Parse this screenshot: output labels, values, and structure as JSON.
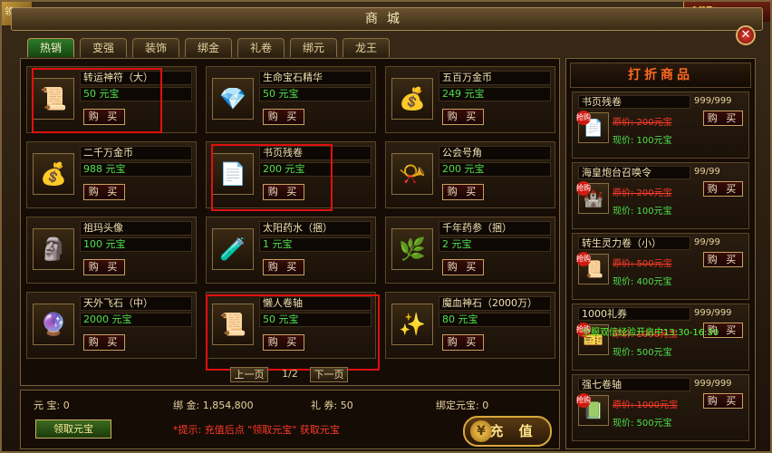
{
  "corner_badge": "领取",
  "vip_badge": "VIP",
  "window": {
    "title": "商城",
    "close": "✕"
  },
  "tabs": [
    "热销",
    "变强",
    "装饰",
    "绑金",
    "礼卷",
    "绑元",
    "龙王"
  ],
  "buy_label": "购 买",
  "items": [
    {
      "name": "转运神符（大）",
      "price": "50 元宝",
      "icon": "talisman-icon",
      "glyph": "📜"
    },
    {
      "name": "生命宝石精华",
      "price": "50 元宝",
      "icon": "red-gem-icon",
      "glyph": "💎"
    },
    {
      "name": "五百万金币",
      "price": "249 元宝",
      "icon": "gold-coin-bag-icon",
      "glyph": "💰"
    },
    {
      "name": "二千万金币",
      "price": "988 元宝",
      "icon": "gold-coin-bag-icon",
      "glyph": "💰"
    },
    {
      "name": "书页残卷",
      "price": "200 元宝",
      "icon": "scroll-page-icon",
      "glyph": "📄"
    },
    {
      "name": "公会号角",
      "price": "200 元宝",
      "icon": "horn-icon",
      "glyph": "📯"
    },
    {
      "name": "祖玛头像",
      "price": "100 元宝",
      "icon": "statue-icon",
      "glyph": "🗿"
    },
    {
      "name": "太阳药水（捆）",
      "price": "1 元宝",
      "icon": "potion-bundle-icon",
      "glyph": "🧪"
    },
    {
      "name": "千年药参（捆）",
      "price": "2 元宝",
      "icon": "ginseng-bundle-icon",
      "glyph": "🌿"
    },
    {
      "name": "天外飞石（中）",
      "price": "2000 元宝",
      "icon": "crystal-stone-icon",
      "glyph": "🔮"
    },
    {
      "name": "懒人卷轴",
      "price": "50 元宝",
      "icon": "scroll-icon",
      "glyph": "📜"
    },
    {
      "name": "魔血神石（2000万）",
      "price": "80 元宝",
      "icon": "blue-orb-icon",
      "glyph": "✨"
    }
  ],
  "pager": {
    "prev": "上一页",
    "page": "1/2",
    "next": "下一页"
  },
  "stats": {
    "yuanbao": "元 宝: 0",
    "bindgold": "绑 金: 1,854,800",
    "coupon": "礼 券: 50",
    "bound_yuanbao": "绑定元宝: 0"
  },
  "claim_button": "领取元宝",
  "tip": "*提示: 充值后点 \"领取元宝\" 获取元宝",
  "recharge_button": "充 值",
  "discount": {
    "title": "打折商品",
    "tag": "抢购",
    "items": [
      {
        "name": "书页残卷",
        "stock": "999/999",
        "orig": "原价: 200元宝",
        "now": "现价: 100元宝",
        "icon": "scroll-page-icon",
        "glyph": "📄"
      },
      {
        "name": "海皇炮台召唤令",
        "stock": "99/99",
        "orig": "原价: 200元宝",
        "now": "现价: 100元宝",
        "icon": "cannon-tower-icon",
        "glyph": "🏰"
      },
      {
        "name": "转生灵力卷（小）",
        "stock": "99/99",
        "orig": "原价: 500元宝",
        "now": "现价: 400元宝",
        "icon": "scroll-icon",
        "glyph": "📜"
      },
      {
        "name": "1000礼券",
        "stock": "999/999",
        "orig": "原价: 1000元宝",
        "now": "现价: 500元宝",
        "icon": "coupon-icon",
        "glyph": "🎫"
      },
      {
        "name": "强七卷轴",
        "stock": "999/999",
        "orig": "原价: 1000元宝",
        "now": "现价: 500元宝",
        "icon": "upgrade-scroll-icon",
        "glyph": "📗"
      }
    ]
  },
  "overlay_message": "全服双倍经验开启中13:30-16:30"
}
